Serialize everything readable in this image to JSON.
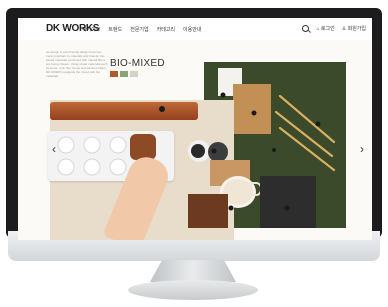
{
  "nav": {
    "logo": "DK WORKS",
    "menu": [
      "아카이브",
      "트렌드",
      "전문기업",
      "카테고리",
      "이용안내"
    ],
    "login": "로그인",
    "mypage": "회원가입"
  },
  "hero": {
    "title": "BIO-MIXED",
    "intro": "As design & cost-friendly design becomes more important to materials and brands, bio-based materials combined with natural fibers are being chosen. Using mixed materials such as wood, cork, flax, hemp and bamboo fibers, DK WORKS suggests the mixed with bio materials.",
    "swatch_colors": [
      "#b15a2b",
      "#8aa37a",
      "#d8d2c6"
    ]
  },
  "colors": {
    "board": "#e8dccb",
    "green": "#3a4a2a",
    "leather": "#a8532a",
    "cork": "#c29055",
    "bamboo": "#d9b060",
    "mug": "#efe6d6",
    "tray": "#f3f3f3"
  }
}
